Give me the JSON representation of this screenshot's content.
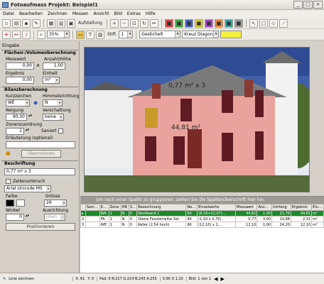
{
  "window": {
    "title": "Fotoaufmass  Projekt: Beispiel1"
  },
  "menu": [
    "Datei",
    "Bearbeiten",
    "Zeichnen",
    "Messen",
    "Ansicht",
    "Bild",
    "Extras",
    "Hilfe"
  ],
  "toolbar1": {
    "layout_label": "Aufstellung"
  },
  "toolbar2": {
    "zoom": "35%",
    "stift_label": "Stift",
    "stift_value": "1",
    "hatch": "Gestichelt",
    "pattern": "Kreuz Diagonal"
  },
  "left": {
    "tab": "Eingabe",
    "area": {
      "title": "Flächen-/Volumenberechnung",
      "messwert_label": "Messwert",
      "anzahl_label": "Anzahl/Höhe",
      "messwert": "0,00",
      "anzahl": "1,00",
      "ergebnis_label": "Ergebnis",
      "einheit_label": "Einheit",
      "ergebnis": "0,00",
      "einheit": "m²"
    },
    "bilanz": {
      "title": "Bilanzberechnung",
      "kurz_label": "Kurzzeichen",
      "himmel_label": "Himmelsrichtung",
      "kurz": "WE",
      "himmel": "N",
      "neigung_label": "Neigung",
      "verschattung_label": "Verschattung",
      "neigung": "90,00",
      "verschattung": "keine",
      "zone_label": "Zonenzuordnung",
      "zone": "1",
      "saniert_label": "Saniert",
      "erl_label": "Erläuterung (optional)",
      "btn": "Übernehmen"
    },
    "beschriftung": {
      "title": "Beschriftung",
      "text": "0,77 m² x 3",
      "zeilenumbruch": "Zeilenumbruch",
      "font": "Arial Unicode MS",
      "farbe_label": "Farbe",
      "groesse_label": "Grösse",
      "groesse": "26",
      "winkel_label": "Winkel",
      "ausricht_label": "Ausrichtung",
      "winkel": "0",
      "ausrichtung": "oben",
      "pos_btn": "Positionieren"
    }
  },
  "image": {
    "annot1": "0,77 m² x 3",
    "annot2": "44,81 m²"
  },
  "grid": {
    "tip": "Um nach einer Spalte zu gruppieren, ziehen Sie die Spaltenüberschrift hier hin.",
    "headers": [
      "",
      "Sani...",
      "K...",
      "Zone",
      "HR",
      "V...",
      "Bezeichnung",
      "Ne...",
      "Einzelwerte",
      "Messwert",
      "Anz...",
      "Umfang",
      "Ergebnis",
      "Ein..."
    ],
    "rows": [
      [
        "▸",
        "",
        "WA",
        "1",
        "N",
        "0",
        "Nordwand 1",
        "90",
        "(8,19+12,07)...",
        "44,81",
        "1,00",
        "21,76",
        "44,81",
        "m²"
      ],
      [
        "2",
        "",
        "FA",
        "1",
        "N",
        "0",
        "Obere Fensterreihe 3et",
        "90",
        "(1,10 x 0,70)",
        "0,77",
        "3,00",
        "10,68",
        "2,31",
        "m²"
      ],
      [
        "3",
        "",
        "WE",
        "1",
        "N",
        "0",
        "Keller (2,54 hoch)",
        "90",
        "(12,10) x 2,...",
        "12,10",
        "1,00",
        "24,20",
        "12,10",
        "m²"
      ]
    ]
  },
  "status": {
    "mode": "Linie zeichnen",
    "x": "X: 61",
    "y": "Y: 0",
    "pad": "Pad: 0 R:217 G:214 B:243 A:255",
    "size": "0,90 X 1,10",
    "page": "Bild: 1 von 1"
  }
}
